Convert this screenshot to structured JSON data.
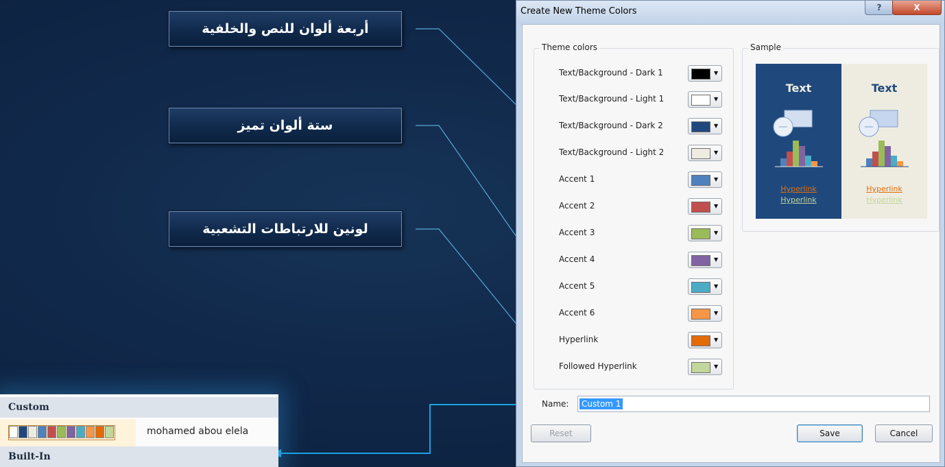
{
  "callouts": {
    "text_background": "أربعة ألوان للنص والخلفية",
    "accents": "ستة ألوان تميز",
    "hyperlinks": "لونين للارتباطات التشعبية"
  },
  "dialog": {
    "title": "Create New Theme Colors",
    "help_label": "?",
    "close_label": "X",
    "theme_colors_legend": "Theme colors",
    "sample_legend": "Sample",
    "rows": [
      {
        "label": "Text/Background - Dark 1",
        "color": "#000000"
      },
      {
        "label": "Text/Background - Light 1",
        "color": "#ffffff"
      },
      {
        "label": "Text/Background - Dark 2",
        "color": "#1f497d"
      },
      {
        "label": "Text/Background - Light 2",
        "color": "#eeece1"
      },
      {
        "label": "Accent 1",
        "color": "#4f81bd"
      },
      {
        "label": "Accent 2",
        "color": "#c0504d"
      },
      {
        "label": "Accent 3",
        "color": "#9bbb59"
      },
      {
        "label": "Accent 4",
        "color": "#8064a2"
      },
      {
        "label": "Accent 5",
        "color": "#4bacc6"
      },
      {
        "label": "Accent 6",
        "color": "#f79646"
      },
      {
        "label": "Hyperlink",
        "color": "#e36c09"
      },
      {
        "label": "Followed Hyperlink",
        "color": "#c3d69b"
      }
    ],
    "sample": {
      "text_label": "Text",
      "hyperlink_label": "Hyperlink",
      "followed_label": "Hyperlink"
    },
    "name_label": "Name:",
    "name_value": "Custom 1",
    "reset_label": "Reset",
    "save_label": "Save",
    "cancel_label": "Cancel"
  },
  "menu": {
    "custom_header": "Custom",
    "custom_item": "mohamed abou elela",
    "builtin_header": "Built-In"
  },
  "colors": {
    "callout_line": "#5aa8d6",
    "arrow": "#1aa3e0",
    "brace": "#5aa8d6"
  }
}
